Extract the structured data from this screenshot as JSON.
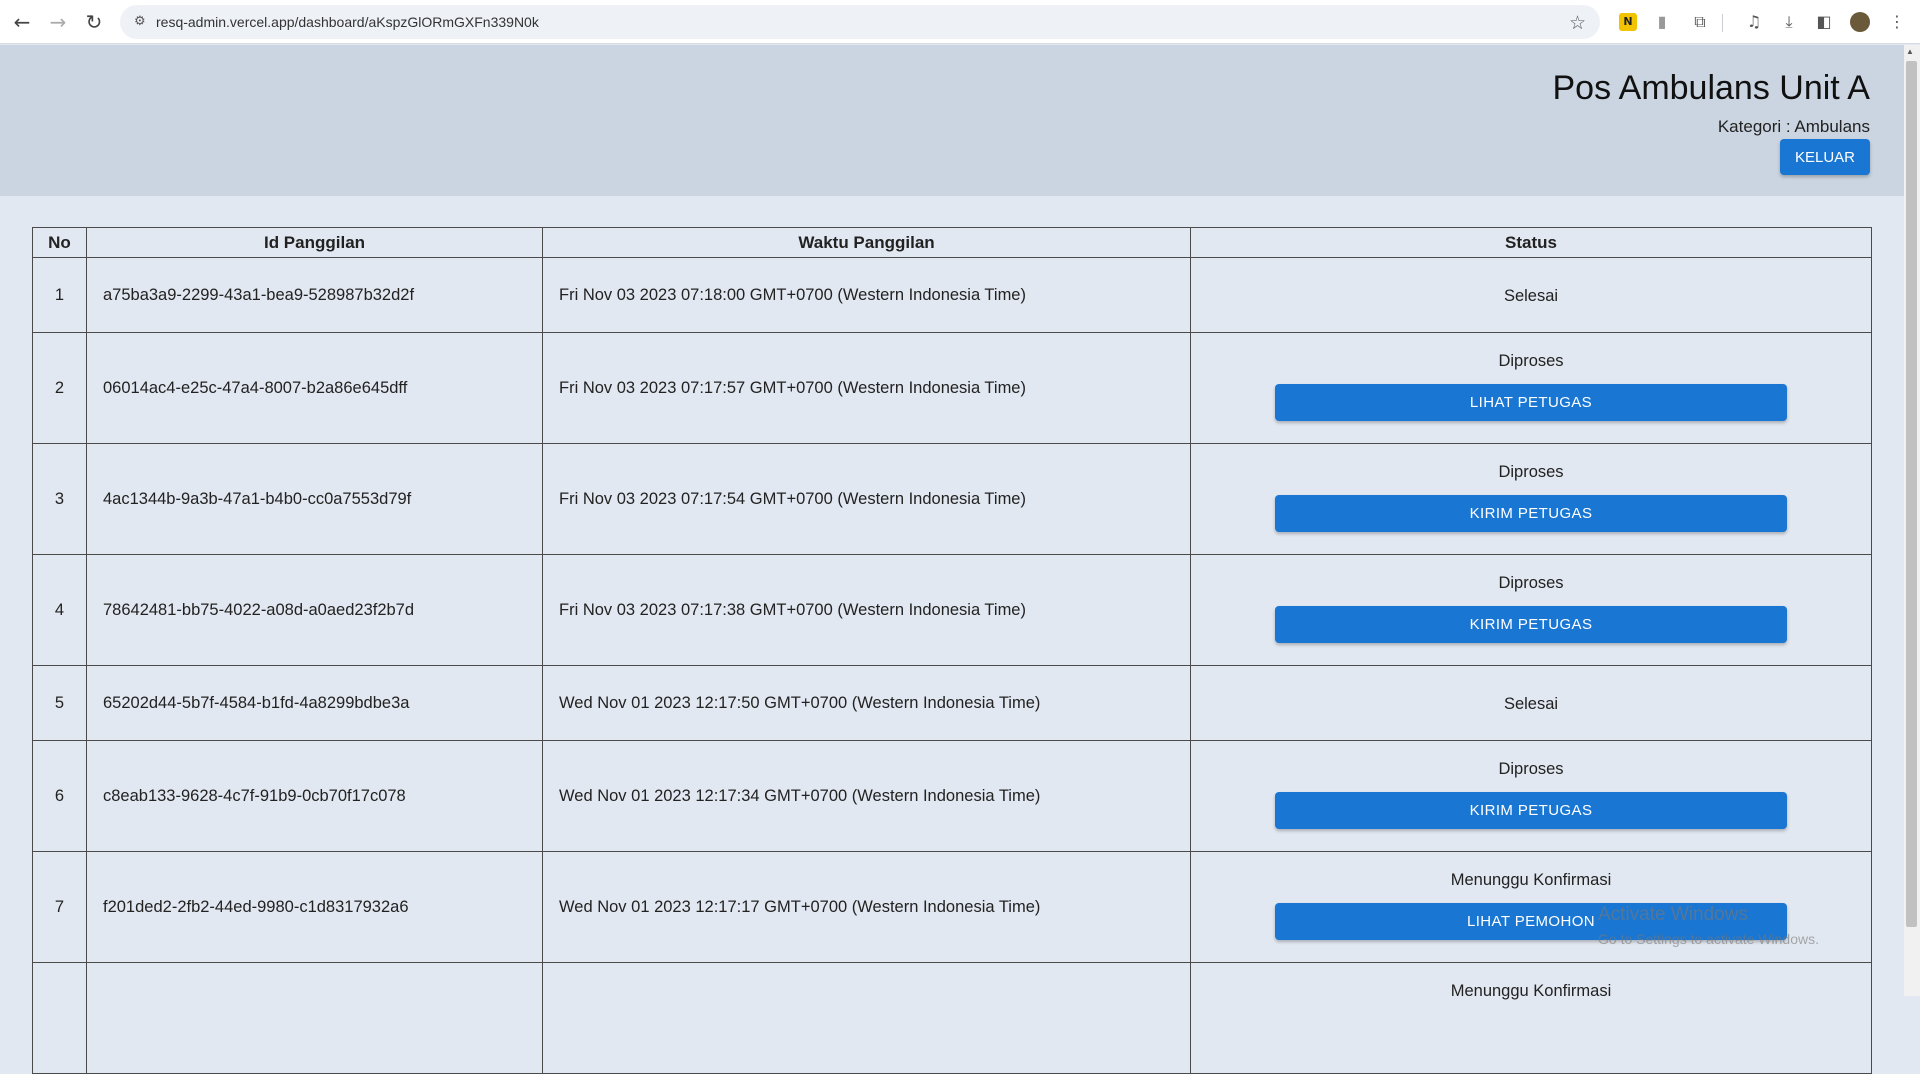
{
  "browser": {
    "url": "resq-admin.vercel.app/dashboard/aKspzGlORmGXFn339N0k",
    "icons": [
      "back-icon",
      "forward-icon",
      "reload-icon",
      "site-settings-icon",
      "bookmark-star-icon",
      "norton-extension-icon",
      "signal-extension-icon",
      "extensions-icon",
      "media-control-icon",
      "downloads-icon",
      "side-panel-icon",
      "profile-avatar-icon",
      "menu-icon"
    ]
  },
  "header": {
    "title": "Pos Ambulans Unit A",
    "kategori": "Kategori : Ambulans",
    "logout_label": "KELUAR",
    "background": "#cbd5e1",
    "accent": "#1976d2"
  },
  "table": {
    "columns": [
      "No",
      "Id Panggilan",
      "Waktu Panggilan",
      "Status"
    ],
    "rows": [
      {
        "no": "1",
        "id": "a75ba3a9-2299-43a1-bea9-528987b32d2f",
        "time": "Fri Nov 03 2023 07:18:00 GMT+0700 (Western Indonesia Time)",
        "status": "Selesai",
        "action": ""
      },
      {
        "no": "2",
        "id": "06014ac4-e25c-47a4-8007-b2a86e645dff",
        "time": "Fri Nov 03 2023 07:17:57 GMT+0700 (Western Indonesia Time)",
        "status": "Diproses",
        "action": "LIHAT PETUGAS"
      },
      {
        "no": "3",
        "id": "4ac1344b-9a3b-47a1-b4b0-cc0a7553d79f",
        "time": "Fri Nov 03 2023 07:17:54 GMT+0700 (Western Indonesia Time)",
        "status": "Diproses",
        "action": "KIRIM PETUGAS"
      },
      {
        "no": "4",
        "id": "78642481-bb75-4022-a08d-a0aed23f2b7d",
        "time": "Fri Nov 03 2023 07:17:38 GMT+0700 (Western Indonesia Time)",
        "status": "Diproses",
        "action": "KIRIM PETUGAS"
      },
      {
        "no": "5",
        "id": "65202d44-5b7f-4584-b1fd-4a8299bdbe3a",
        "time": "Wed Nov 01 2023 12:17:50 GMT+0700 (Western Indonesia Time)",
        "status": "Selesai",
        "action": ""
      },
      {
        "no": "6",
        "id": "c8eab133-9628-4c7f-91b9-0cb70f17c078",
        "time": "Wed Nov 01 2023 12:17:34 GMT+0700 (Western Indonesia Time)",
        "status": "Diproses",
        "action": "KIRIM PETUGAS"
      },
      {
        "no": "7",
        "id": "f201ded2-2fb2-44ed-9980-c1d8317932a6",
        "time": "Wed Nov 01 2023 12:17:17 GMT+0700 (Western Indonesia Time)",
        "status": "Menunggu Konfirmasi",
        "action": "LIHAT PEMOHON"
      },
      {
        "no": "",
        "id": "",
        "time": "",
        "status": "Menunggu Konfirmasi",
        "action": ""
      }
    ]
  },
  "watermark": {
    "line1": "Activate Windows",
    "line2": "Go to Settings to activate Windows."
  }
}
